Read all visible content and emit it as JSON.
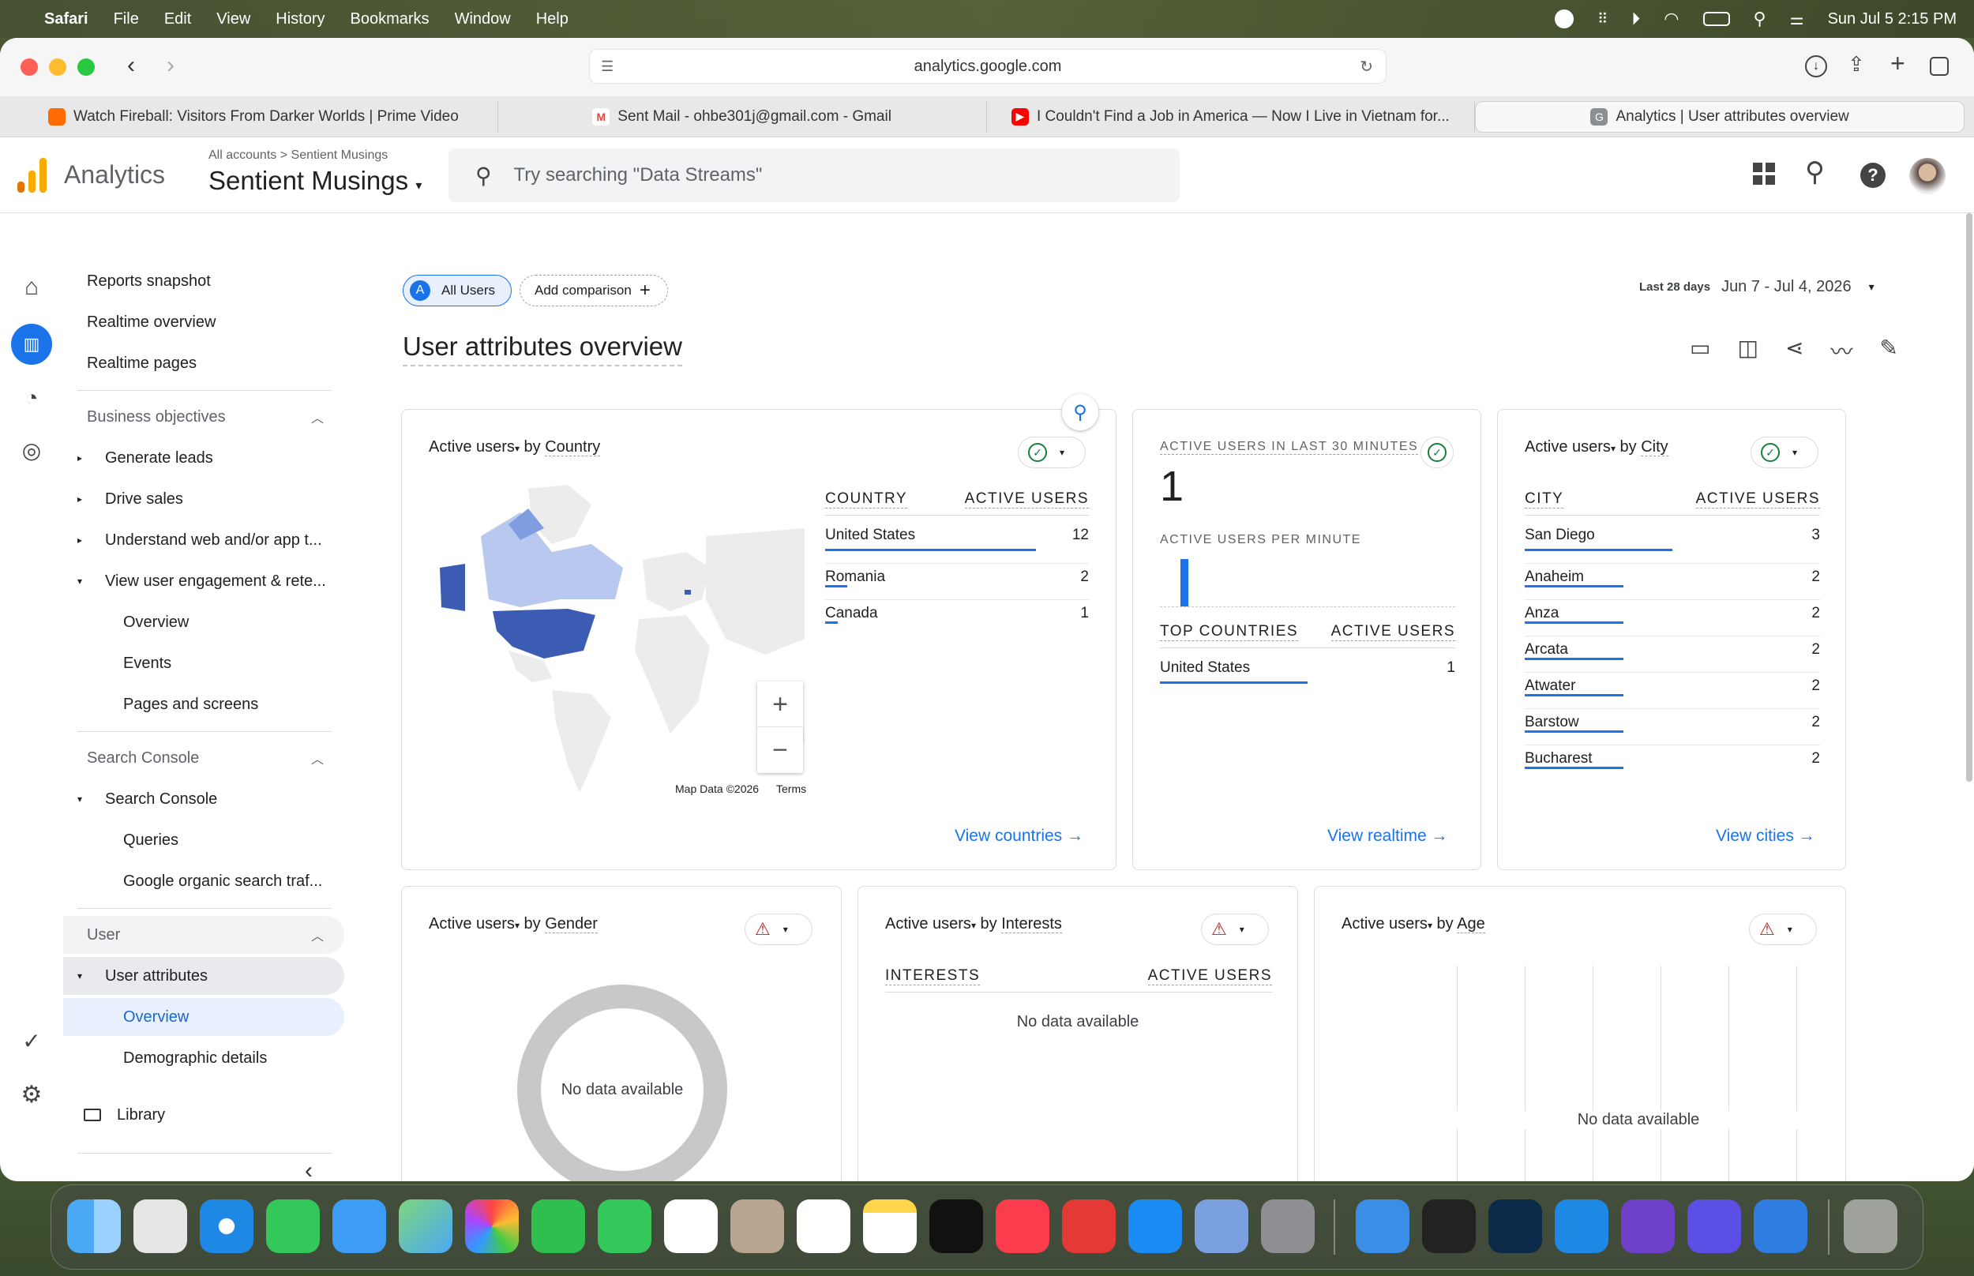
{
  "menubar": {
    "app": "Safari",
    "items": [
      "File",
      "Edit",
      "View",
      "History",
      "Bookmarks",
      "Window",
      "Help"
    ],
    "datetime": "Sun Jul 5  2:15 PM"
  },
  "browser": {
    "url": "analytics.google.com",
    "tabs": [
      {
        "title": "Watch Fireball: Visitors From Darker Worlds | Prime Video",
        "color": "#ff6a00"
      },
      {
        "title": "Sent Mail - ohbe301j@gmail.com - Gmail",
        "color": "#ea4335"
      },
      {
        "title": "I Couldn't Find a Job in America — Now I Live in Vietnam for...",
        "color": "#ff0000"
      },
      {
        "title": "Analytics | User attributes overview",
        "color": "#5f6368"
      }
    ]
  },
  "header": {
    "product": "Analytics",
    "breadcrumb_root": "All accounts",
    "breadcrumb_sep": ">",
    "breadcrumb_account": "Sentient Musings",
    "property": "Sentient Musings",
    "search_placeholder": "Try searching \"Data Streams\""
  },
  "nav": {
    "top": [
      "Reports snapshot",
      "Realtime overview",
      "Realtime pages"
    ],
    "business": {
      "label": "Business objectives",
      "items": [
        "Generate leads",
        "Drive sales",
        "Understand web and/or app t...",
        "View user engagement & rete..."
      ],
      "sub": [
        "Overview",
        "Events",
        "Pages and screens"
      ]
    },
    "search_console": {
      "label": "Search Console",
      "item": "Search Console",
      "sub": [
        "Queries",
        "Google organic search traf..."
      ]
    },
    "user": {
      "label": "User",
      "item": "User attributes",
      "sub": [
        "Overview",
        "Demographic details"
      ]
    },
    "library": "Library"
  },
  "toolbar": {
    "segment_letter": "A",
    "segment": "All Users",
    "add_comparison": "Add comparison",
    "date_label": "Last 28 days",
    "date_range": "Jun 7 - Jul 4, 2026"
  },
  "page_title": "User attributes overview",
  "country_card": {
    "metric": "Active users",
    "by": "by",
    "dim": "Country",
    "col1": "COUNTRY",
    "col2": "ACTIVE USERS",
    "rows": [
      {
        "name": "United States",
        "value": 12
      },
      {
        "name": "Romania",
        "value": 2
      },
      {
        "name": "Canada",
        "value": 1
      }
    ],
    "map_credit": "Map Data ©2026",
    "terms": "Terms",
    "link": "View countries"
  },
  "realtime_card": {
    "title": "ACTIVE USERS IN LAST 30 MINUTES",
    "value": "1",
    "per_minute": "ACTIVE USERS PER MINUTE",
    "col1": "TOP COUNTRIES",
    "col2": "ACTIVE USERS",
    "rows": [
      {
        "name": "United States",
        "value": 1
      }
    ],
    "link": "View realtime"
  },
  "city_card": {
    "metric": "Active users",
    "by": "by",
    "dim": "City",
    "col1": "CITY",
    "col2": "ACTIVE USERS",
    "rows": [
      {
        "name": "San Diego",
        "value": 3
      },
      {
        "name": "Anaheim",
        "value": 2
      },
      {
        "name": "Anza",
        "value": 2
      },
      {
        "name": "Arcata",
        "value": 2
      },
      {
        "name": "Atwater",
        "value": 2
      },
      {
        "name": "Barstow",
        "value": 2
      },
      {
        "name": "Bucharest",
        "value": 2
      }
    ],
    "link": "View cities"
  },
  "gender_card": {
    "metric": "Active users",
    "by": "by",
    "dim": "Gender",
    "empty": "No data available"
  },
  "interests_card": {
    "metric": "Active users",
    "by": "by",
    "dim": "Interests",
    "col1": "INTERESTS",
    "col2": "ACTIVE USERS",
    "empty": "No data available"
  },
  "age_card": {
    "metric": "Active users",
    "by": "by",
    "dim": "Age",
    "empty": "No data available"
  },
  "colors": {
    "accent": "#1a73e8",
    "map_dark": "#3c5cb3",
    "map_mid": "#7f9de0",
    "map_light": "#b9c8ef",
    "land": "#ececec"
  }
}
